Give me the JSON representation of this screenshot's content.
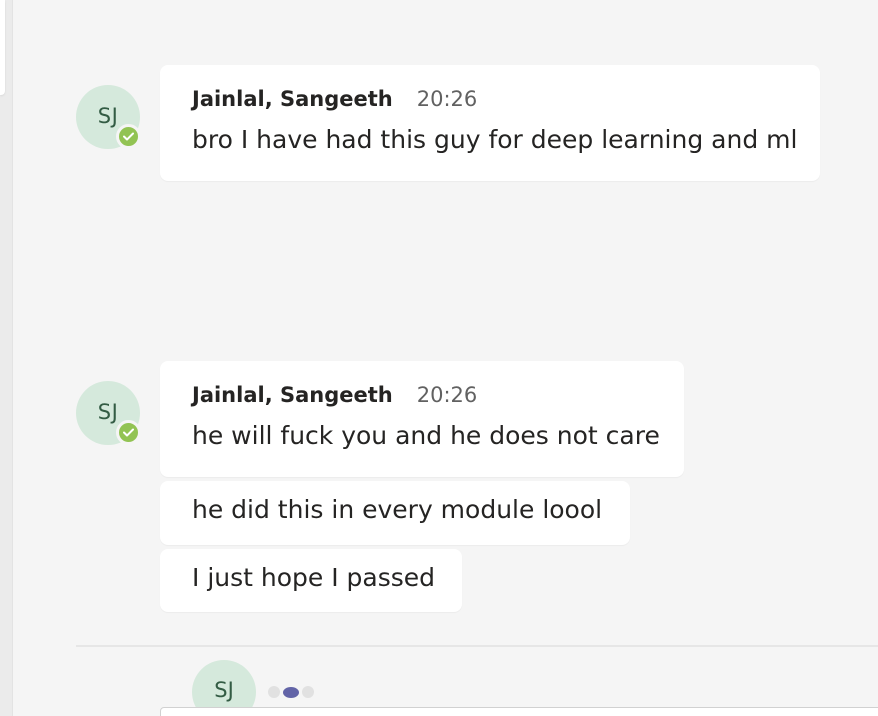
{
  "colors": {
    "background": "#f5f5f5",
    "bubble": "#ffffff",
    "avatar_bg": "#d5e9dc",
    "avatar_text": "#335c44",
    "presence_available": "#92c353",
    "typing_accent": "#6264a7"
  },
  "messages": [
    {
      "avatar_initials": "SJ",
      "author": "Jainlal, Sangeeth",
      "time": "20:26",
      "lines": [
        "bro I have had this guy for deep learning and ml"
      ]
    },
    {
      "avatar_initials": "SJ",
      "author": "Jainlal, Sangeeth",
      "time": "20:26",
      "lines": [
        "he will fuck you and he does not care",
        "he did this in every module loool",
        "I just hope I passed"
      ]
    }
  ],
  "typing_indicator": {
    "avatar_initials": "SJ",
    "icon": "typing-dots-icon"
  },
  "presence_icon": "check-icon"
}
